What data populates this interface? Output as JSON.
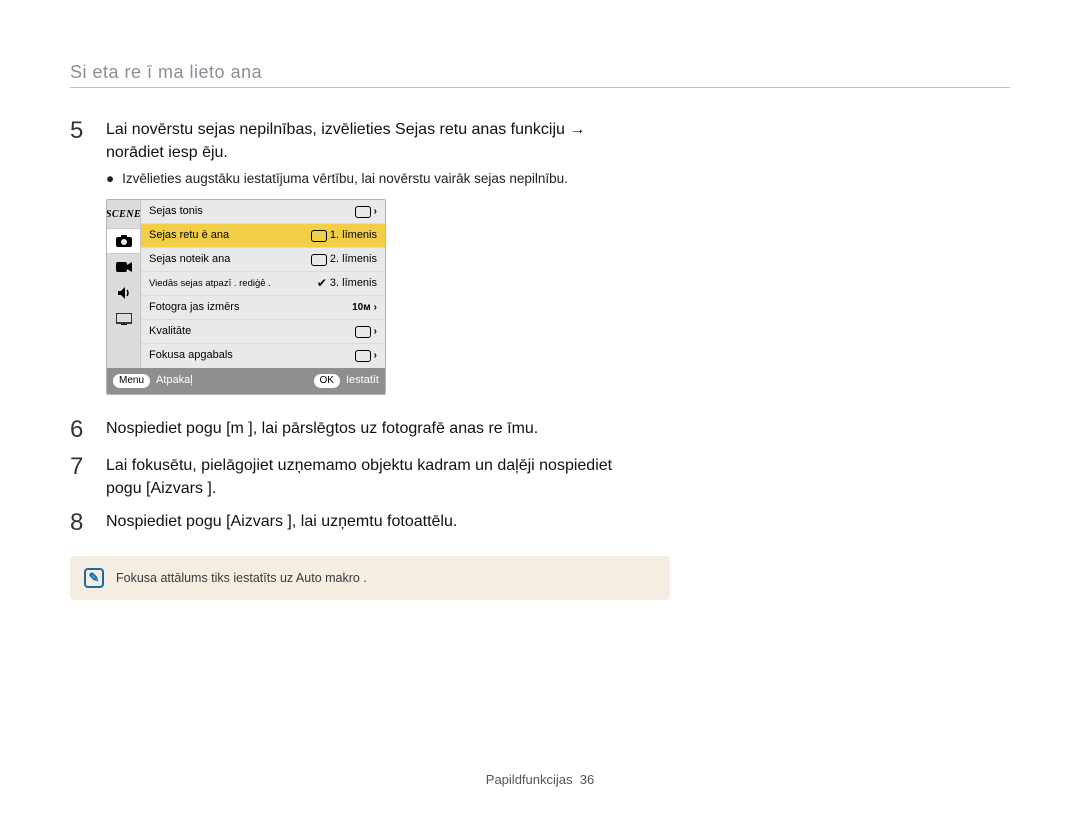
{
  "header": "Si eta re ī ma lieto ana",
  "steps": {
    "5": {
      "num": "5",
      "text": "Lai novērstu sejas nepilnības, izvēlieties Sejas retu   anas funkciju → norādiet iesp    ēju.",
      "bullet": "Izvēlieties augstāku iestatījuma vērtību, lai novērstu vairāk sejas nepilnību."
    },
    "6": {
      "num": "6",
      "text": "Nospiediet pogu [m       ], lai pārslēgtos uz fotografē anas re īmu."
    },
    "7": {
      "num": "7",
      "text": "Lai fokusētu, pielāgojiet uzņemamo objektu kadram un daļēji nospiediet pogu [Aizvars ]."
    },
    "8": {
      "num": "8",
      "text": "Nospiediet pogu [Aizvars ], lai uzņemtu fotoattēlu."
    }
  },
  "device": {
    "side": {
      "scene": "SCENE"
    },
    "rows": [
      {
        "label": "Sejas tonis",
        "level": "",
        "hi": false
      },
      {
        "label": "Sejas retu  ē ana",
        "level": "1. līmenis",
        "hi": true
      },
      {
        "label": "Sejas noteik ana",
        "level": "2. līmenis",
        "hi": false
      },
      {
        "label": "Viedās sejas atpazī . rediģē .",
        "level": "3. līmenis",
        "hi": false
      },
      {
        "label": "Fotogra  jas izmērs",
        "val": "10м",
        "hi": false
      },
      {
        "label": "Kvalitāte",
        "val": "",
        "hi": false
      },
      {
        "label": "Fokusa apgabals",
        "val": "",
        "hi": false
      }
    ],
    "footer": {
      "menu": "Menu",
      "back": "Atpakaļ",
      "ok": "OK",
      "set": "Iestatīt"
    }
  },
  "note": "Fokusa attālums tiks iestatīts uz Auto makro  .",
  "footer": {
    "section": "Papildfunkcijas",
    "page": "36"
  }
}
